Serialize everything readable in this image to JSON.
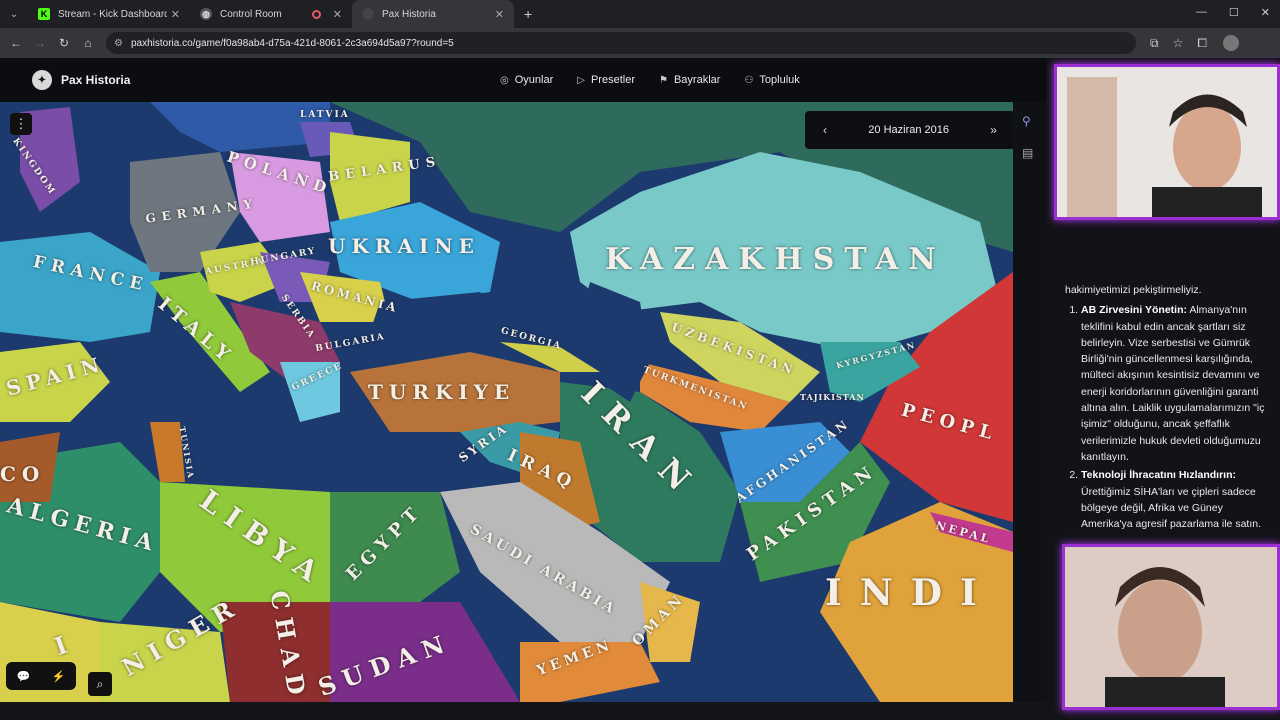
{
  "browser": {
    "tabs": [
      {
        "title": "Stream - Kick Dashboard",
        "favicon": "kick-icon"
      },
      {
        "title": "Control Room",
        "favicon": "globe-icon"
      },
      {
        "title": "Pax Historia",
        "favicon": "pax-icon",
        "active": true
      }
    ],
    "url": "paxhistoria.co/game/f0a98ab4-d75a-421d-8061-2c3a694d5a97?round=5"
  },
  "app": {
    "brand": "Pax Historia",
    "nav": [
      "Oyunlar",
      "Presetler",
      "Bayraklar",
      "Topluluk"
    ]
  },
  "game": {
    "date": "20 Haziran 2016",
    "map_labels": [
      "POLAND",
      "BELARUS",
      "UKRAINE",
      "GERMANY",
      "FRANCE",
      "ITALY",
      "AUSTRIA",
      "HUNGARY",
      "ROMANIA",
      "BULGARIA",
      "SERBIA",
      "GREECE",
      "KAZAKHSTAN",
      "UZBEKISTAN",
      "TURKMENISTAN",
      "KYRGYZSTAN",
      "TAJIKISTAN",
      "TURKIYE",
      "GEORGIA",
      "SYRIA",
      "IRAQ",
      "IRAN",
      "AFGHANISTAN",
      "PAKISTAN",
      "PEOPL",
      "NEPAL",
      "INDI",
      "ALGERIA",
      "LIBYA",
      "EGYPT",
      "SAUDI ARABIA",
      "YEMEN",
      "OMAN",
      "SUDAN",
      "NIGER",
      "CHAD",
      "SPAIN",
      "TUNISIA",
      "LATVIA",
      "KINGDOM",
      "CO",
      "I"
    ]
  },
  "chat": {
    "intro": "hakimiyetimizi pekiştirmeliyiz.",
    "items": [
      {
        "title": "AB Zirvesini Yönetin:",
        "body": "Almanya'nın teklifini kabul edin ancak şartları siz belirleyin. Vize serbestisi ve Gümrük Birliği'nin güncellenmesi karşılığında, mülteci akışının kesintisiz devamını ve enerji koridorlarının güvenliğini garanti altına alın. Laiklik uygulamalarımızın \"iç işimiz\" olduğunu, ancak şeffaflık verilerimizle hukuk devleti olduğumuzu kanıtlayın."
      },
      {
        "title": "Teknoloji İhracatını Hızlandırın:",
        "body": "Ürettiğimiz SİHA'ları ve çipleri sadece bölgeye değil, Afrika ve Güney Amerika'ya agresif pazarlama ile satın."
      }
    ]
  },
  "colors": {
    "accent": "#9b2fd1",
    "sea": "#1d3a6e"
  }
}
